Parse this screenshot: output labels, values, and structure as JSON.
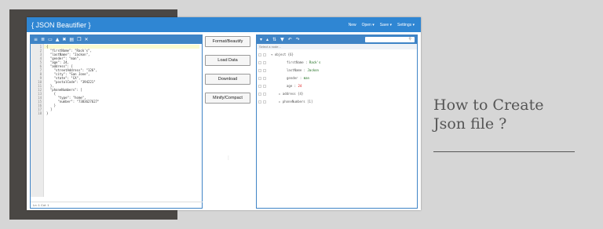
{
  "app": {
    "title": "{ JSON Beautifier }"
  },
  "header_nav": [
    "New",
    "Open ▾",
    "Save ▾",
    "Settings ▾"
  ],
  "editor": {
    "toolbar_icons": [
      "format-icon",
      "compact-icon",
      "folder-icon",
      "upload-icon",
      "close-icon",
      "print-icon",
      "copy-icon",
      "expand-icon"
    ],
    "line_numbers": [
      "1",
      "2",
      "3",
      "4",
      "5",
      "6",
      "7",
      "8",
      "9",
      "10",
      "11",
      "12",
      "13",
      "14",
      "15",
      "16",
      "17",
      "18"
    ],
    "code_lines": [
      "{",
      "  \"firstName\": \"Rack's\",",
      "  \"lastName\": \"Jackon\",",
      "  \"gender\": \"man\",",
      "  \"age\": 24,",
      "  \"address\": {",
      "    \"streetAddress\": \"126\",",
      "    \"city\": \"San Jone\",",
      "    \"state\": \"CA\",",
      "    \"postalCode\": \"394221\"",
      "  },",
      "  \"phoneNumbers\": [",
      "    {",
      "      \"type\": \"home\",",
      "      \"number\": \"7383627627\"",
      "    }",
      "  ]",
      "}"
    ],
    "status": "Ln: 1    Col: 1"
  },
  "buttons": {
    "format": "Format/Beautify",
    "load": "Load Data",
    "download": "Download",
    "minify": "Minify/Compact"
  },
  "tree": {
    "breadcrumb": "Select a node...",
    "rows": [
      {
        "text": "▾  object {6}",
        "type": "root"
      },
      {
        "key": "firstName",
        "value": "Rack's",
        "type": "str"
      },
      {
        "key": "lastName",
        "value": "Jackon",
        "type": "str"
      },
      {
        "key": "gender",
        "value": "man",
        "type": "str"
      },
      {
        "key": "age",
        "value": "24",
        "type": "num"
      },
      {
        "text": "▸  address {4}",
        "type": "obj"
      },
      {
        "text": "▸  phoneNumbers [1]",
        "type": "obj"
      }
    ]
  },
  "side": {
    "title_line1": "How to Create",
    "title_line2": "Json file ?"
  },
  "colors": {
    "accent": "#2f86d3",
    "panel_border": "#3f84c6",
    "background": "#d6d6d6",
    "dark_block": "#4a4744"
  }
}
